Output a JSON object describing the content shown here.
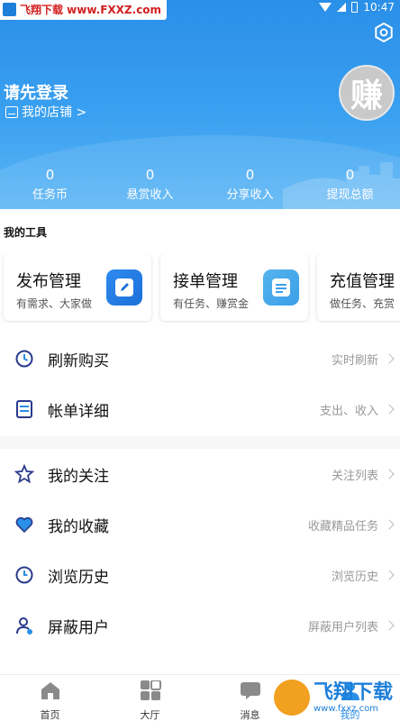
{
  "colors": {
    "header_blue": "#2a8fe8",
    "accent_blue": "#2a8fe8",
    "hint_gray": "#999999"
  },
  "status": {
    "time": "10:47"
  },
  "watermark": {
    "text": "飞翔下载 www.FXXZ.com"
  },
  "profile": {
    "login_title": "请先登录",
    "shop_link": "我的店铺 >",
    "avatar_char": "赚"
  },
  "stats": [
    {
      "value": "0",
      "label": "任务币"
    },
    {
      "value": "0",
      "label": "悬赏收入"
    },
    {
      "value": "0",
      "label": "分享收入"
    },
    {
      "value": "0",
      "label": "提现总额"
    }
  ],
  "tools": {
    "title": "我的工具",
    "cards": [
      {
        "title": "发布管理",
        "subtitle": "有需求、大家做",
        "icon": "edit-icon"
      },
      {
        "title": "接单管理",
        "subtitle": "有任务、赚赏金",
        "icon": "note-icon"
      },
      {
        "title": "充值管理",
        "subtitle": "做任务、充赏",
        "icon": "wallet-icon"
      }
    ]
  },
  "menu": [
    {
      "label": "刷新购买",
      "hint": "实时刷新",
      "icon": "clock-refresh-icon"
    },
    {
      "label": "帐单详细",
      "hint": "支出、收入",
      "icon": "bill-icon"
    },
    {
      "label": "我的关注",
      "hint": "关注列表",
      "icon": "star-icon"
    },
    {
      "label": "我的收藏",
      "hint": "收藏精品任务",
      "icon": "heart-icon"
    },
    {
      "label": "浏览历史",
      "hint": "浏览历史",
      "icon": "history-icon"
    },
    {
      "label": "屏蔽用户",
      "hint": "屏蔽用户列表",
      "icon": "block-user-icon"
    }
  ],
  "bottom_nav": [
    {
      "label": "首页",
      "icon": "home-icon",
      "active": false
    },
    {
      "label": "大厅",
      "icon": "grid-icon",
      "active": false
    },
    {
      "label": "消息",
      "icon": "message-icon",
      "active": false
    },
    {
      "label": "我的",
      "icon": "user-icon",
      "active": true
    }
  ],
  "logo_badge": {
    "text": "飞翔下载",
    "url": "www.fxxz.com"
  }
}
